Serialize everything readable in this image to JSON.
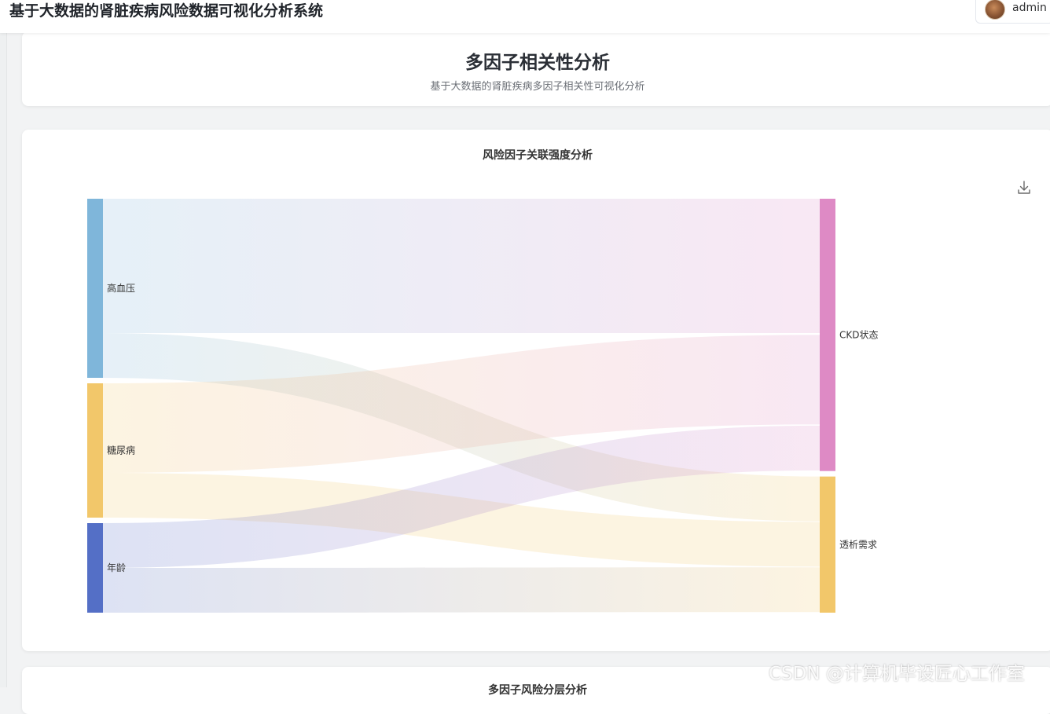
{
  "app": {
    "title": "基于大数据的肾脏疾病风险数据可视化分析系统",
    "user": "admin"
  },
  "header": {
    "title": "多因子相关性分析",
    "subtitle": "基于大数据的肾脏疾病多因子相关性可视化分析"
  },
  "chart_card": {
    "title": "风险因子关联强度分析",
    "download_icon": "download-icon"
  },
  "chart_data": {
    "type": "sankey",
    "title": "风险因子关联强度分析",
    "nodes": [
      {
        "name": "高血压",
        "color": "#7fb6da"
      },
      {
        "name": "糖尿病",
        "color": "#f2c76a"
      },
      {
        "name": "年龄",
        "color": "#546fc6"
      },
      {
        "name": "CKD状态",
        "color": "#de8ac5"
      },
      {
        "name": "透析需求",
        "color": "#f2c76a"
      }
    ],
    "links": [
      {
        "source": "高血压",
        "target": "CKD状态",
        "value": 3.0
      },
      {
        "source": "高血压",
        "target": "透析需求",
        "value": 1.0
      },
      {
        "source": "糖尿病",
        "target": "CKD状态",
        "value": 2.0
      },
      {
        "source": "糖尿病",
        "target": "透析需求",
        "value": 1.0
      },
      {
        "source": "年龄",
        "target": "CKD状态",
        "value": 1.0
      },
      {
        "source": "年龄",
        "target": "透析需求",
        "value": 1.0
      }
    ]
  },
  "next_card": {
    "title": "多因子风险分层分析"
  },
  "watermark": "CSDN @计算机毕设匠心工作室"
}
